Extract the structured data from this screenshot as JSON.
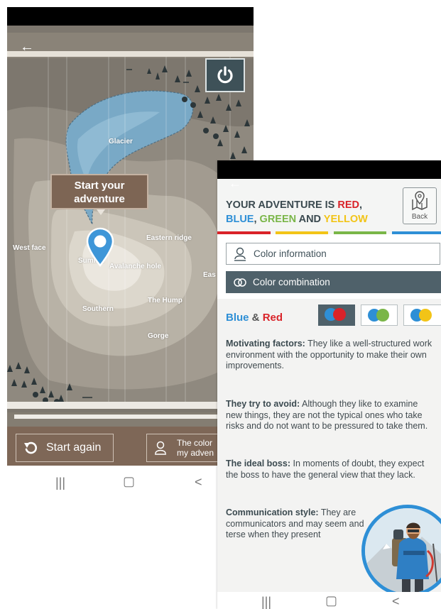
{
  "map": {
    "tooltip": "Start your adventure",
    "labels": {
      "glacier": "Glacier",
      "west_face": "West face",
      "summit": "Summit",
      "avalanche_hole": "Avalanche hole",
      "eastern_ridge": "Eastern ridge",
      "east": "Eas",
      "southern": "Southern",
      "the_hump": "The Hump",
      "gorge": "Gorge"
    }
  },
  "left_bottom": {
    "start_again": "Start again",
    "color_adventure_line1": "The color",
    "color_adventure_line2": "my adven"
  },
  "nav": {
    "recent": "|||",
    "home": "▢",
    "back": "<"
  },
  "result": {
    "heading_prefix": "YOUR ADVENTURE IS ",
    "red": "RED",
    "comma": ",",
    "blue": "BLUE",
    "sep1": ", ",
    "green": "GREEN",
    "and": " AND ",
    "yellow": "YELLOW",
    "back_label": "Back",
    "color_information": "Color information",
    "color_combination": "Color combination",
    "combo_blue": "Blue",
    "combo_amp": " & ",
    "combo_red": "Red",
    "motivating_title": "Motivating factors:",
    "motivating_text": "They like a well-structured work environment with the opportunity to make their own improvements.",
    "avoid_title": "They try to avoid:",
    "avoid_text": "Although they like to examine new things, they are not the typical ones who take risks and do not want to be pressured to take them.",
    "boss_title": "The ideal boss:",
    "boss_text": "In moments of doubt, they expect the boss to have the general view that they lack.",
    "comm_title": "Communication style:",
    "comm_text": "They are communicators and may seem and terse when they present"
  },
  "colors": {
    "red": "#d92329",
    "blue": "#2e8fd6",
    "green": "#7ab648",
    "yellow": "#f2c417",
    "dark_slate": "#4f616a",
    "brown": "#7e6757"
  }
}
